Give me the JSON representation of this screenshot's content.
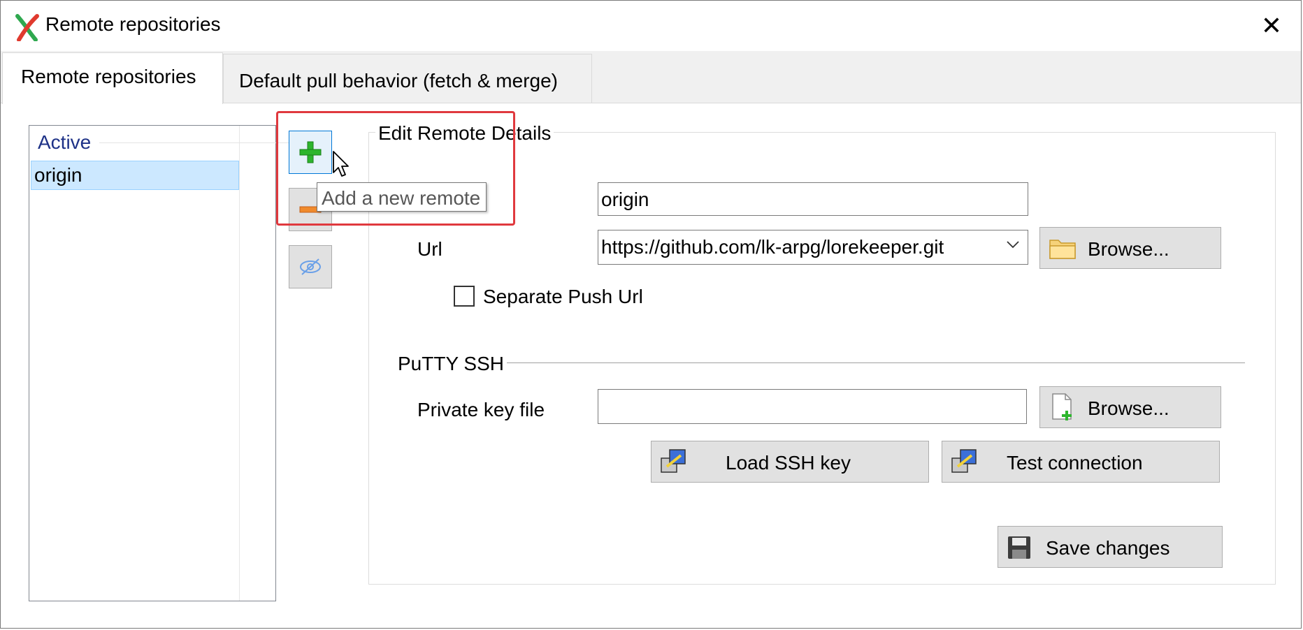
{
  "window": {
    "title": "Remote repositories",
    "close_glyph": "✕"
  },
  "tabs": [
    {
      "label": "Remote repositories",
      "active": true
    },
    {
      "label": "Default pull behavior (fetch & merge)",
      "active": false
    }
  ],
  "remotes_list": {
    "group_header": "Active",
    "items": [
      "origin"
    ],
    "selected": "origin"
  },
  "side_buttons": [
    {
      "name": "add-remote",
      "icon": "green-plus-icon",
      "hover": true
    },
    {
      "name": "remove-remote",
      "icon": "orange-minus-icon"
    },
    {
      "name": "toggle-remote",
      "icon": "eye-slash-icon"
    }
  ],
  "tooltip": {
    "text": "Add a new remote"
  },
  "edit_details": {
    "legend": "Edit Remote Details",
    "name_value": "origin",
    "url_label": "Url",
    "url_value": "https://github.com/lk-arpg/lorekeeper.git",
    "browse_url_label": "Browse...",
    "separate_push_label": "Separate Push Url",
    "separate_push_checked": false
  },
  "putty": {
    "section_label": "PuTTY SSH",
    "key_label": "Private key file",
    "key_value": "",
    "browse_key_label": "Browse...",
    "load_key_label": "Load SSH key",
    "test_connection_label": "Test connection"
  },
  "save_label": "Save changes",
  "colors": {
    "highlight_box": "#e0393e",
    "selection": "#cce8ff",
    "group_header": "#1e3287"
  }
}
